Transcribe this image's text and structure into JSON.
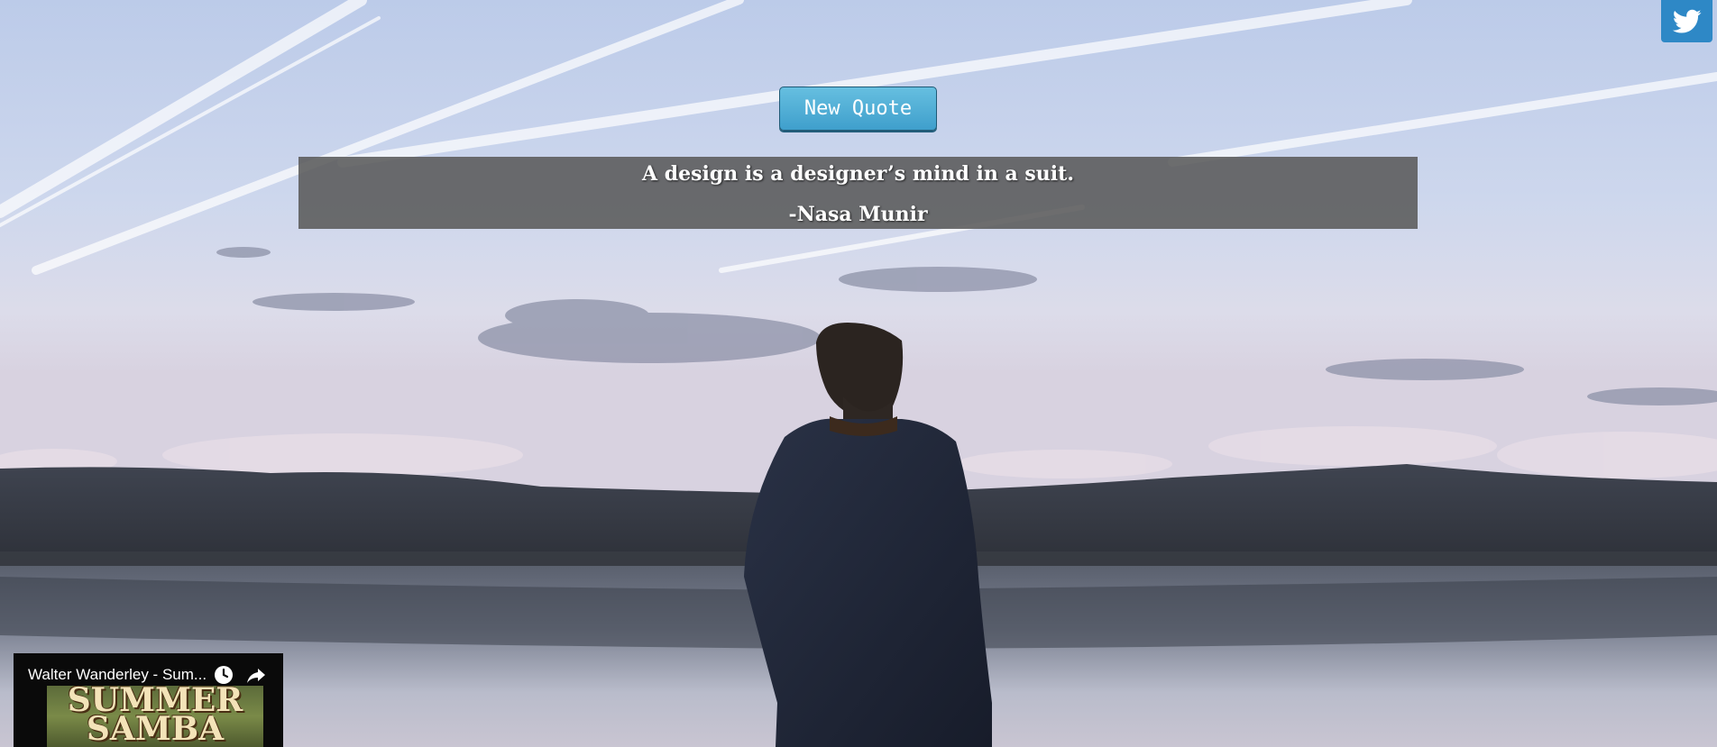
{
  "page": {
    "background_scene": "silhouette-of-man-facing-lake-at-dusk"
  },
  "twitter": {
    "icon": "twitter-bird-icon",
    "color": "#2e88c6"
  },
  "quote_button": {
    "label": "New Quote",
    "color": "#4aaad4"
  },
  "quote": {
    "text": "A design is a designer’s mind in a suit.",
    "author": "-Nasa Munir"
  },
  "video": {
    "title": "Walter Wanderley - Sum...",
    "watch_later_icon": "clock-icon",
    "share_icon": "share-arrow-icon",
    "album_art_text": "SUMMER\nSAMBA"
  }
}
